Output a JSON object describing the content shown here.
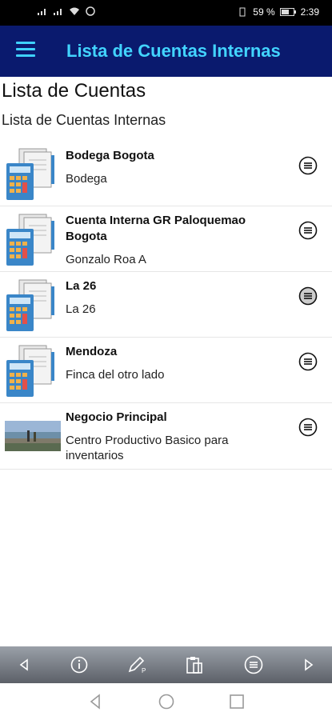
{
  "status": {
    "battery": "59 %",
    "time": "2:39"
  },
  "appbar": {
    "title": "Lista de Cuentas Internas"
  },
  "page": {
    "heading": "Lista de Cuentas",
    "subheading": "Lista de Cuentas Internas"
  },
  "accounts": [
    {
      "title": "Bodega Bogota",
      "desc": "Bodega",
      "thumb": "calculator-document-icon"
    },
    {
      "title": "Cuenta Interna GR Paloquemao Bogota",
      "desc": "Gonzalo Roa A",
      "thumb": "calculator-document-icon"
    },
    {
      "title": "La 26",
      "desc": "La 26",
      "thumb": "calculator-document-icon"
    },
    {
      "title": "Mendoza",
      "desc": "Finca del otro lado",
      "thumb": "calculator-document-icon"
    },
    {
      "title": "Negocio Principal",
      "desc": "Centro Productivo Basico para inventarios",
      "thumb": "photo-thumbnail"
    }
  ],
  "toolbar": {
    "icons": [
      "back-arrow-icon",
      "info-icon",
      "edit-icon",
      "paste-icon",
      "list-menu-icon",
      "forward-arrow-icon"
    ]
  },
  "navbar": {
    "icons": [
      "nav-back-icon",
      "nav-home-icon",
      "nav-recents-icon"
    ]
  },
  "colors": {
    "appbar": "#0a1a6e",
    "accent": "#42d4ff"
  }
}
